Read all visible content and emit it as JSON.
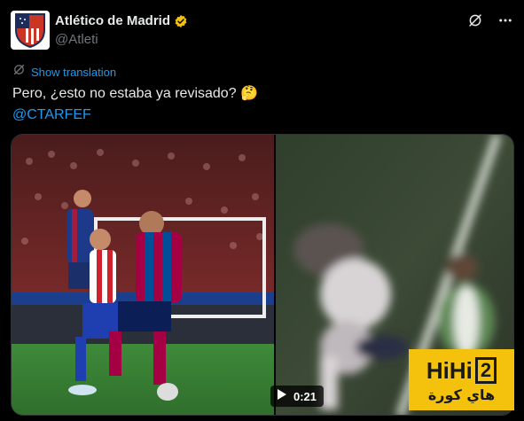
{
  "account": {
    "display_name": "Atlético de Madrid",
    "handle": "@Atleti",
    "verified_icon": "verified-badge-icon",
    "verified_color": "#f4c20d"
  },
  "header_actions": {
    "icons": [
      "grok-icon",
      "more-icon"
    ]
  },
  "translation": {
    "label": "Show translation",
    "icon": "translate-icon"
  },
  "tweet": {
    "text": "Pero, ¿esto no estaba ya revisado? 🤔",
    "mention": "@CTARFEF",
    "link_color": "#1d9bf0"
  },
  "media": {
    "photo_icon": "football-photo",
    "video": {
      "duration": "0:21",
      "icon": "play-icon"
    }
  },
  "watermark": {
    "top_text": "HiHi",
    "badge": "2",
    "bottom_text": "هاي كورة",
    "color": "#f4c20d"
  }
}
